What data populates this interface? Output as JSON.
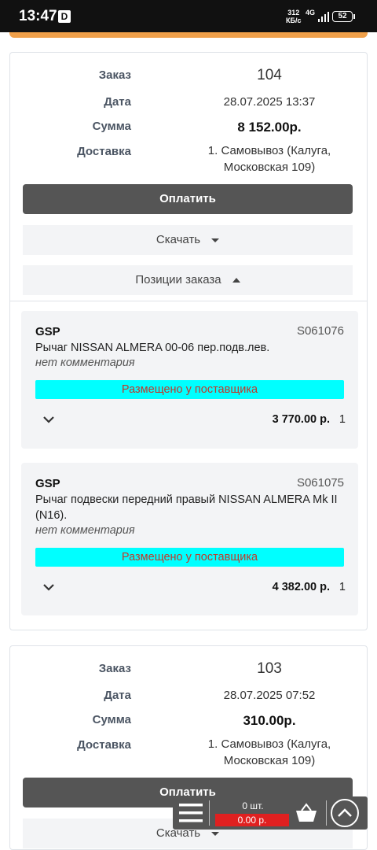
{
  "status_bar": {
    "time": "13:47",
    "d_badge": "D",
    "net_speed": "312",
    "net_unit": "КБ/с",
    "net_type": "4G",
    "battery": "52"
  },
  "orders": [
    {
      "labels": {
        "order": "Заказ",
        "date": "Дата",
        "sum": "Сумма",
        "delivery": "Доставка"
      },
      "number": "104",
      "date": "28.07.2025 13:37",
      "sum": "8 152.00р.",
      "delivery_line1": "1. Самовывоз (Калуга,",
      "delivery_line2": "Московская 109)",
      "pay_label": "Оплатить",
      "download_label": "Скачать",
      "positions_label": "Позиции заказа",
      "items": [
        {
          "supplier": "GSP",
          "code": "S061076",
          "name": "Рычаг NISSAN ALMERA 00-06 пер.подв.лев.",
          "comment": "нет комментария",
          "status": "Размещено у поставщика",
          "price": "3 770.00 р.",
          "qty": "1"
        },
        {
          "supplier": "GSP",
          "code": "S061075",
          "name": "Рычаг подвески передний правый NISSAN ALMERA Mk II (N16).",
          "comment": "нет комментария",
          "status": "Размещено у поставщика",
          "price": "4 382.00 р.",
          "qty": "1"
        }
      ]
    },
    {
      "labels": {
        "order": "Заказ",
        "date": "Дата",
        "sum": "Сумма",
        "delivery": "Доставка"
      },
      "number": "103",
      "date": "28.07.2025 07:52",
      "sum": "310.00р.",
      "delivery_line1": "1. Самовывоз (Калуга,",
      "delivery_line2": "Московская 109)",
      "pay_label": "Оплатить",
      "download_label": "Скачать"
    }
  ],
  "cart_bar": {
    "count": "0 шт.",
    "total": "0.00 р."
  },
  "colors": {
    "status_bg": "#00ffff",
    "status_text": "#c0392b",
    "pay_button": "#555555",
    "accent_orange": "#f0a04a",
    "cart_total_bg": "#e02020"
  }
}
